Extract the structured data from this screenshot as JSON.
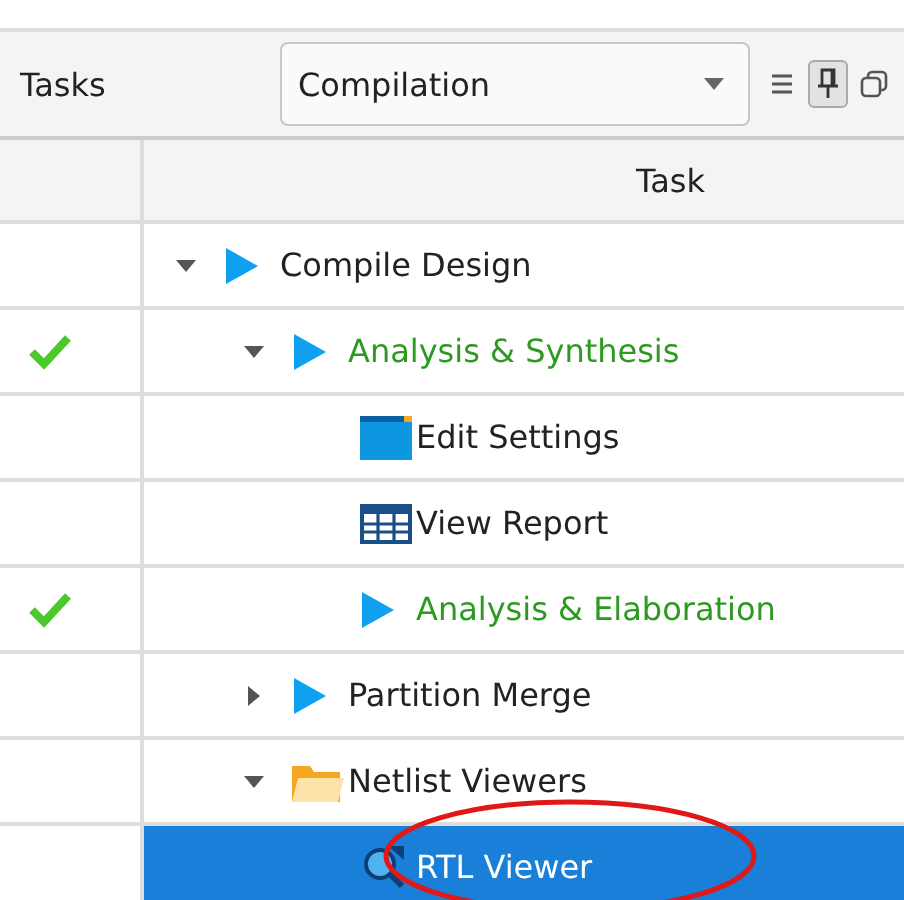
{
  "panel": {
    "title": "Tasks",
    "flow": {
      "value": "Compilation"
    },
    "toolbar": [
      {
        "kind": "menu",
        "pressed": false
      },
      {
        "kind": "pin",
        "pressed": true
      },
      {
        "kind": "restore",
        "pressed": false
      }
    ]
  },
  "table": {
    "columns": [
      "Task"
    ],
    "tasks": [
      {
        "label": "Compile Design",
        "kind": "play",
        "done": false,
        "selected": false,
        "expanded": true,
        "children": [
          {
            "label": "Analysis & Synthesis",
            "kind": "play",
            "done": true,
            "selected": false,
            "expanded": true,
            "children": [
              {
                "label": "Edit Settings",
                "kind": "settings",
                "done": false,
                "selected": false
              },
              {
                "label": "View Report",
                "kind": "report",
                "done": false,
                "selected": false
              },
              {
                "label": "Analysis & Elaboration",
                "kind": "play",
                "done": true,
                "selected": false
              }
            ]
          },
          {
            "label": "Partition Merge",
            "kind": "play",
            "done": false,
            "selected": false,
            "expanded": false
          },
          {
            "label": "Netlist Viewers",
            "kind": "folder",
            "done": false,
            "selected": false,
            "expanded": true,
            "children": [
              {
                "label": "RTL Viewer",
                "kind": "rtl",
                "done": false,
                "selected": true
              }
            ]
          }
        ]
      }
    ]
  },
  "annotation": {
    "kind": "ellipse",
    "color": "#e01818"
  }
}
